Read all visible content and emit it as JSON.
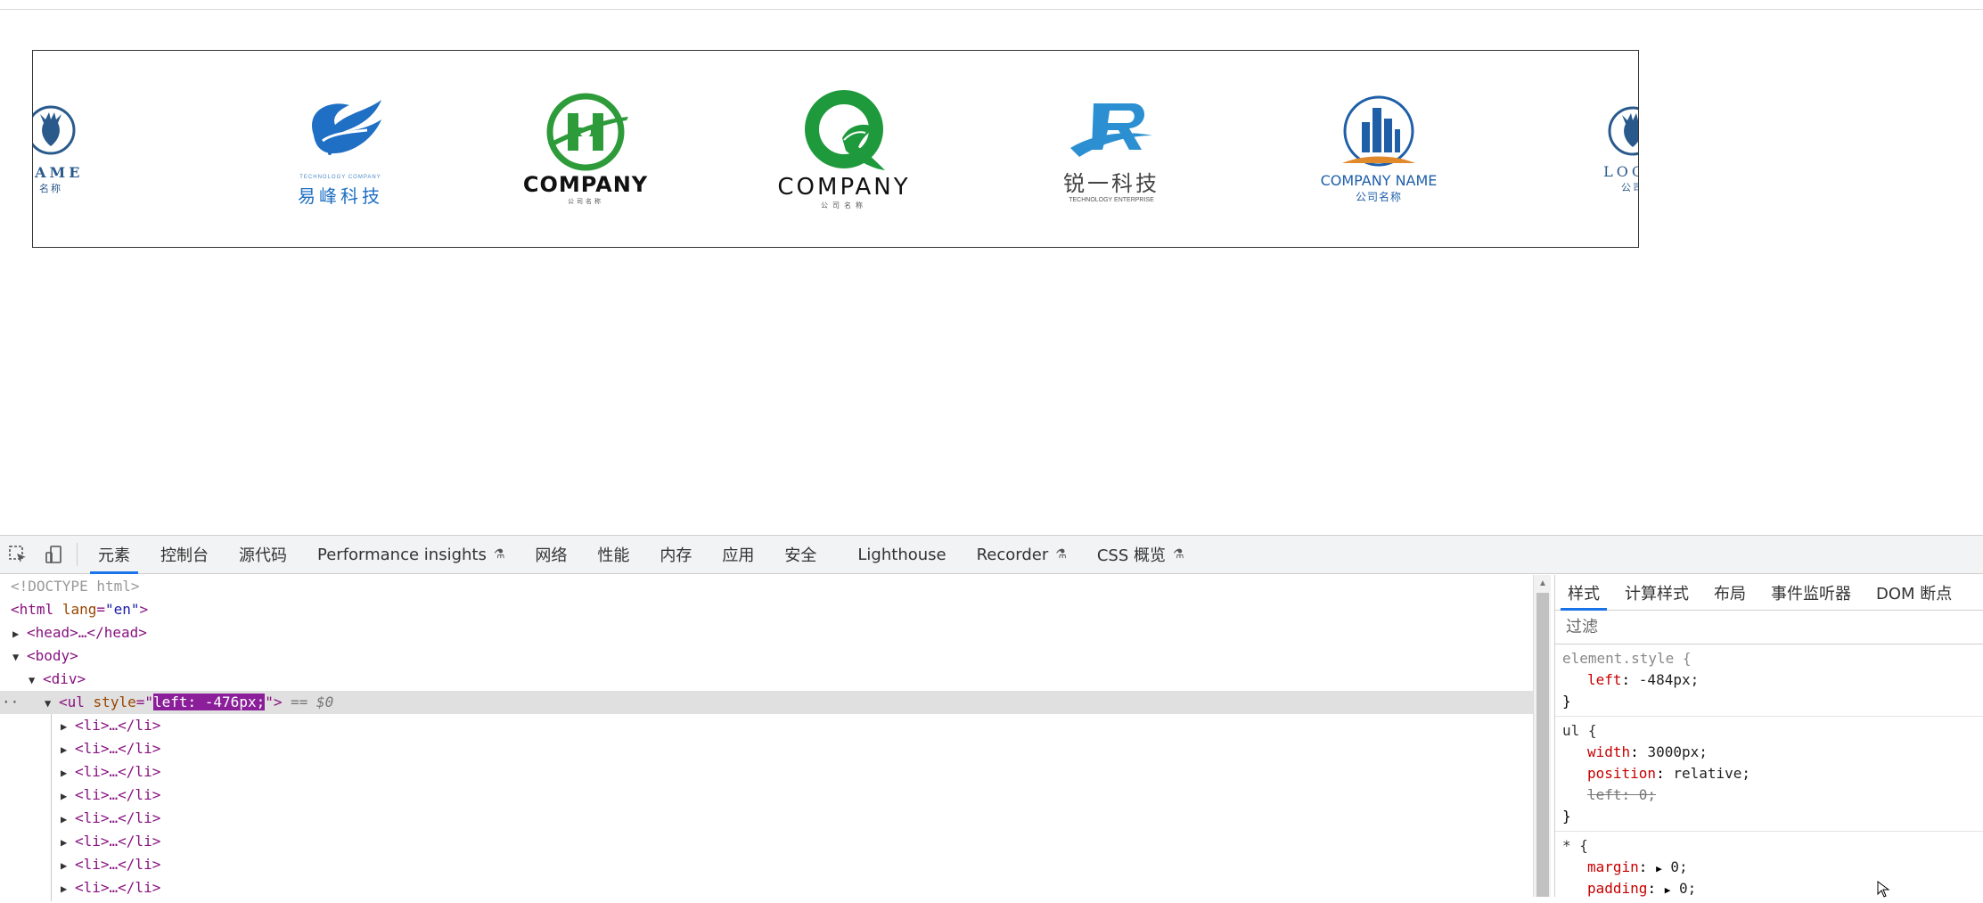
{
  "logos": [
    {
      "name": "deer-logo-left",
      "line1": "NAME",
      "line2": "名称"
    },
    {
      "name": "yifeng-logo",
      "small": "TECHNOLOGY COMPANY",
      "line1": "易峰科技"
    },
    {
      "name": "h-company-logo",
      "line1": "COMPANY",
      "line2": "公司名称"
    },
    {
      "name": "q-company-logo",
      "line1": "COMPANY",
      "line2": "公司名称"
    },
    {
      "name": "ruiyi-logo",
      "line1": "锐一科技",
      "line2": "TECHNOLOGY ENTERPRISE"
    },
    {
      "name": "building-logo",
      "line1": "COMPANY NAME",
      "line2": "公司名称"
    },
    {
      "name": "deer-logo-right",
      "line1": "LOGO",
      "line2": "公司"
    }
  ],
  "devtools": {
    "tabs": [
      "元素",
      "控制台",
      "源代码",
      "Performance insights",
      "网络",
      "性能",
      "内存",
      "应用",
      "安全",
      "Lighthouse",
      "Recorder",
      "CSS 概览"
    ],
    "dom": {
      "doctype": "<!DOCTYPE html>",
      "html_open": "<html",
      "lang_attr": "lang",
      "lang_val": "\"en\"",
      "head": "<head>…</head>",
      "body": "<body>",
      "div": "<div>",
      "ul_tag": "<ul",
      "style_attr": "style",
      "style_val": "left: -476px;",
      "eq": "== $0",
      "li": "<li>…</li>"
    },
    "styles_tabs": [
      "样式",
      "计算样式",
      "布局",
      "事件监听器",
      "DOM 断点"
    ],
    "filter_placeholder": "过滤",
    "rules": {
      "element_style_selector": "element.style {",
      "element_style_prop": "left",
      "element_style_val": "-484px;",
      "ul_selector": "ul {",
      "ul_width_prop": "width",
      "ul_width_val": "3000px;",
      "ul_position_prop": "position",
      "ul_position_val": "relative;",
      "ul_left_struck": "left: 0;",
      "star_selector": "* {",
      "margin_prop": "margin",
      "margin_val": "0;",
      "padding_prop": "padding",
      "padding_val": "0;",
      "close": "}"
    }
  }
}
